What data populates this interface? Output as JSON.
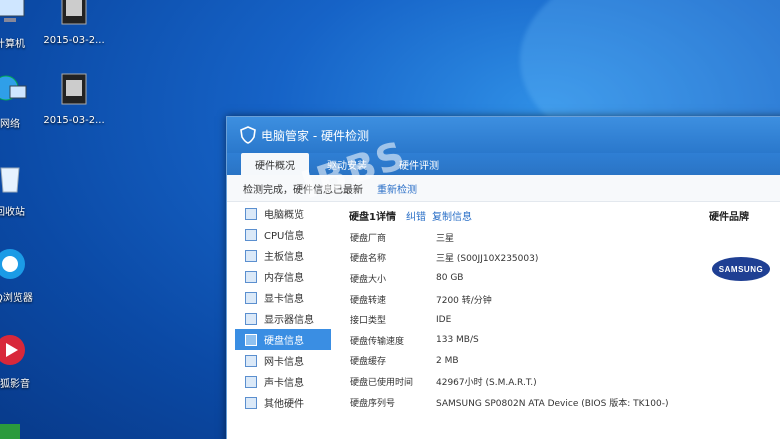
{
  "desktop": {
    "icons": [
      {
        "label": "计算机",
        "name": "computer"
      },
      {
        "label": "2015-03-2...",
        "name": "file1"
      },
      {
        "label": "网络",
        "name": "network"
      },
      {
        "label": "2015-03-2...",
        "name": "file2"
      },
      {
        "label": "回收站",
        "name": "recycle"
      },
      {
        "label": "QQ浏览器",
        "name": "qq-browser"
      },
      {
        "label": "搜狐影音",
        "name": "sohu-video"
      }
    ]
  },
  "window": {
    "title": "电脑管家 - 硬件检测",
    "tabs": [
      "硬件概况",
      "驱动安装",
      "硬件评测"
    ],
    "status": "检测完成，硬件信息已最新",
    "rescan": "重新检测"
  },
  "sidebar": {
    "items": [
      "电脑概览",
      "CPU信息",
      "主板信息",
      "内存信息",
      "显卡信息",
      "显示器信息",
      "硬盘信息",
      "网卡信息",
      "声卡信息",
      "其他硬件"
    ]
  },
  "main": {
    "heading": "硬盘1详情",
    "link_error": "纠错",
    "link_copy": "复制信息",
    "rows": [
      {
        "k": "硬盘厂商",
        "v": "三星"
      },
      {
        "k": "硬盘名称",
        "v": "三星 (S00JJ10X235003)"
      },
      {
        "k": "硬盘大小",
        "v": "80 GB"
      },
      {
        "k": "硬盘转速",
        "v": "7200 转/分钟"
      },
      {
        "k": "接口类型",
        "v": "IDE"
      },
      {
        "k": "硬盘传输速度",
        "v": "133 MB/S"
      },
      {
        "k": "硬盘缓存",
        "v": "2 MB"
      },
      {
        "k": "硬盘已使用时间",
        "v": "42967小时 (S.M.A.R.T.)"
      },
      {
        "k": "硬盘序列号",
        "v": "SAMSUNG SP0802N ATA Device (BIOS 版本: TK100-)"
      }
    ]
  },
  "brand": {
    "heading": "硬件品牌",
    "logo_text": "SAMSUNG"
  },
  "watermark": "IBBS"
}
